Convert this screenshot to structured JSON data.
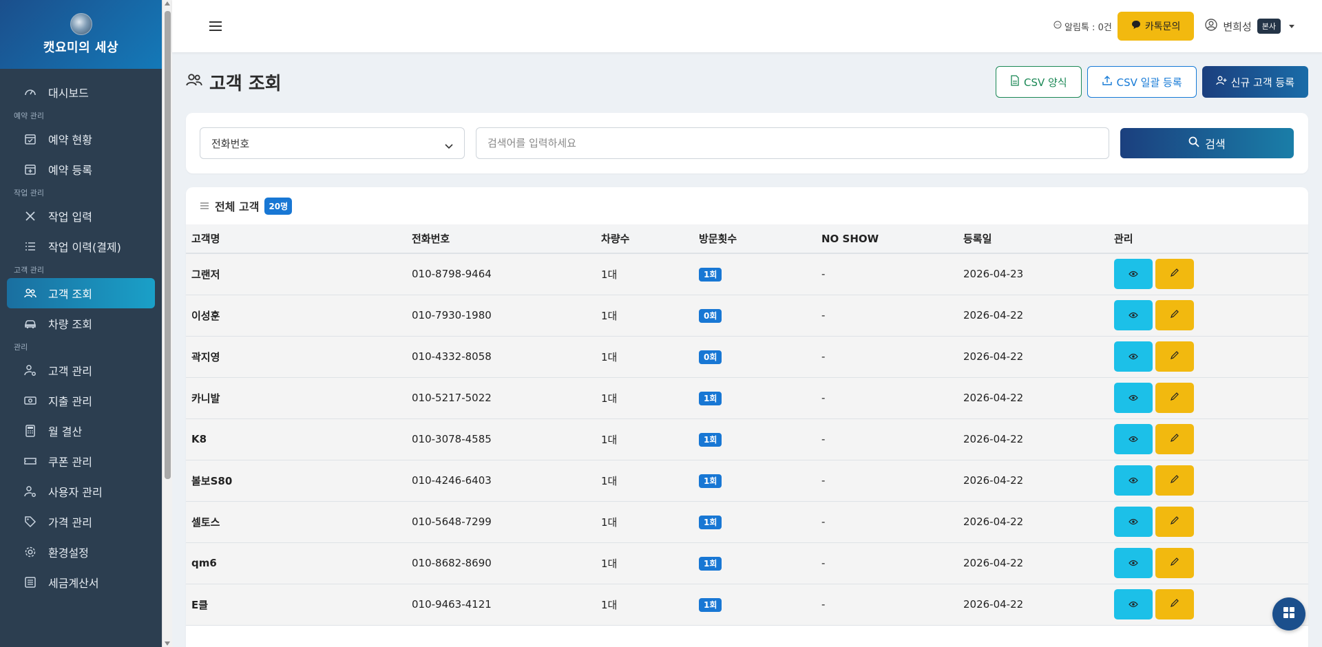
{
  "brand": {
    "name": "캣요미의 세상"
  },
  "sidebar": {
    "dashboard": "대시보드",
    "sections": {
      "reservation": "예약 관리",
      "work": "작업 관리",
      "customer": "고객 관리",
      "admin": "관리"
    },
    "items": {
      "reservation_status": "예약 현황",
      "reservation_register": "예약 등록",
      "work_input": "작업 입력",
      "work_history": "작업 이력(결제)",
      "customer_lookup": "고객 조회",
      "vehicle_lookup": "차량 조회",
      "customer_manage": "고객 관리",
      "expense_manage": "지출 관리",
      "monthly_settle": "월 결산",
      "coupon_manage": "쿠폰 관리",
      "user_manage": "사용자 관리",
      "price_manage": "가격 관리",
      "settings": "환경설정",
      "tax_invoice": "세금계산서"
    }
  },
  "topbar": {
    "alim": "알림톡 : 0건",
    "kakao_label": "카톡문의",
    "user_name": "변희성",
    "user_badge": "본사"
  },
  "page": {
    "title": "고객 조회",
    "btn_csv_form": "CSV 양식",
    "btn_csv_upload": "CSV 일괄 등록",
    "btn_new_customer": "신규 고객 등록"
  },
  "search": {
    "select_value": "전화번호",
    "placeholder": "검색어를 입력하세요",
    "button": "검색"
  },
  "list": {
    "title": "전체 고객",
    "count": "20명",
    "columns": [
      "고객명",
      "전화번호",
      "차량수",
      "방문횟수",
      "NO SHOW",
      "등록일",
      "관리"
    ],
    "rows": [
      {
        "name": "그랜저",
        "phone": "010-8798-9464",
        "cars": "1대",
        "visits": "1회",
        "noshow": "-",
        "date": "2026-04-23"
      },
      {
        "name": "이성훈",
        "phone": "010-7930-1980",
        "cars": "1대",
        "visits": "0회",
        "noshow": "-",
        "date": "2026-04-22"
      },
      {
        "name": "곽지영",
        "phone": "010-4332-8058",
        "cars": "1대",
        "visits": "0회",
        "noshow": "-",
        "date": "2026-04-22"
      },
      {
        "name": "카니발",
        "phone": "010-5217-5022",
        "cars": "1대",
        "visits": "1회",
        "noshow": "-",
        "date": "2026-04-22"
      },
      {
        "name": "K8",
        "phone": "010-3078-4585",
        "cars": "1대",
        "visits": "1회",
        "noshow": "-",
        "date": "2026-04-22"
      },
      {
        "name": "볼보S80",
        "phone": "010-4246-6403",
        "cars": "1대",
        "visits": "1회",
        "noshow": "-",
        "date": "2026-04-22"
      },
      {
        "name": "셀토스",
        "phone": "010-5648-7299",
        "cars": "1대",
        "visits": "1회",
        "noshow": "-",
        "date": "2026-04-22"
      },
      {
        "name": "qm6",
        "phone": "010-8682-8690",
        "cars": "1대",
        "visits": "1회",
        "noshow": "-",
        "date": "2026-04-22"
      },
      {
        "name": "E클",
        "phone": "010-9463-4121",
        "cars": "1대",
        "visits": "1회",
        "noshow": "-",
        "date": "2026-04-22"
      }
    ]
  }
}
